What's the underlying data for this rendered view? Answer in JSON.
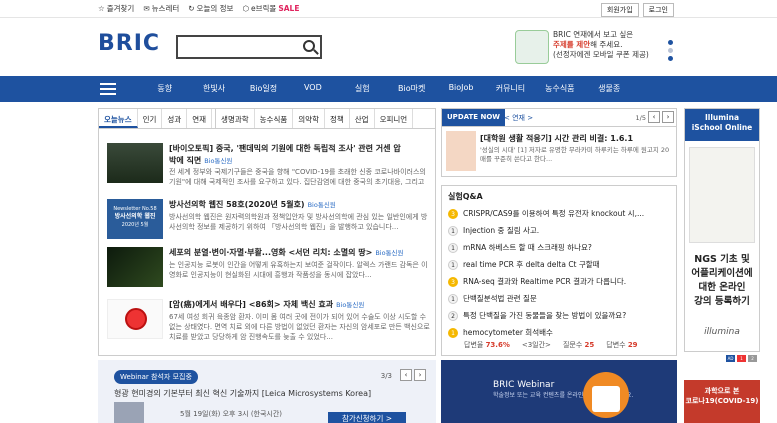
{
  "topbar": {
    "links": [
      "즐겨찾기",
      "뉴스레터",
      "오늘의 정보",
      "e브릭몰"
    ],
    "sale": "SALE",
    "login": "회원가입",
    "logout": "로그인"
  },
  "header": {
    "logo": "BRIC",
    "search_placeholder": "",
    "promo_line1": "BRIC 연재에서 보고 싶은",
    "promo_line2_a": "주제를 제안",
    "promo_line2_b": "해 주세요.",
    "promo_line3": "(선정자에겐 모바일 쿠폰 제공)",
    "dot_colors": [
      "#1e52a0",
      "#b9c3d6",
      "#1e52a0"
    ]
  },
  "nav": {
    "items": [
      "동향",
      "한빛사",
      "Bio일정",
      "VOD",
      "실험",
      "Bio마켓",
      "BioJob",
      "커뮤니티",
      "농수식품",
      "생물종"
    ]
  },
  "left": {
    "tabs": [
      "오늘뉴스",
      "인기",
      "성과",
      "연재",
      "생명과학",
      "농수식품",
      "의약학",
      "정책",
      "산업",
      "오피니언"
    ],
    "news": [
      {
        "title": "[바이오토픽] 중국, '팬데믹의 기원에 대한 독립적 조사' 관련 거센 압",
        "title2": "박에 직면",
        "source": "Bio통신원",
        "desc": "전 세계 정부와 국제기구들은 중국을 향해 \"COVID-19를 초래한 신종 코로나바이러스의 기원\"에 대해 국제적인 조사를 요구하고 있다. 집단감염에 대한 중국의 초기대응, 그리고 팬데믹의 기원에 대한 독립적·국제..."
      },
      {
        "title": "방사선의학 웹진 58호(2020년 5월호)",
        "source": "Bio통신원",
        "thumb_line1": "Newsletter No.58",
        "thumb_line2": "방사선의학 웹진",
        "thumb_line3": "2020년 5월",
        "desc": "방사선의학 웹진은 원자력의학원과 정책입안자 및 방사선의학에 관심 있는 일반인에게 방사선의학 정보를 제공하기 위하여 「방사선의학 웹진」을 발행하고 있습니다..."
      },
      {
        "title": "세포의 분열·변이·자멸·부활...영화 <서던 리치: 소멸의 땅>",
        "source": "Bio통신원",
        "desc": "는 인공지능 로봇이 인간을 어떻게 유혹하는지 보여준 걸작이다. 알렉스 가랜드 감독은 이 영화로 인공지능이 현실화된 시대에 흥행과 작품성을 동시에 잡았다..."
      },
      {
        "title": "[암(癌)에게서 배우다] <86회> 자체 백신 효과",
        "source": "Bio통신원",
        "desc": "67세 여성 회귀 육종암 환자. 이미 몸 여러 곳에 전이가 되어 있어 수술도 이상 시도할 수 없는 상태였다. 면역 치료 외에 다른 방법이 없었던 환자는 자신의 암세포로 만든 백신으로 치료를 받았고 당당하게 암 진행속도를 늦출 수 있었다..."
      }
    ]
  },
  "webinar_banner": {
    "tag": "Webinar 참석자 모집중",
    "page": "3/3",
    "title": "형광 현미경의 기본부터 최신 혁신 기술까지 [Leica Microsystems Korea]",
    "date": "5월 19일(화) 오후 3시 (한국시간)",
    "cta": "참가신청하기 >"
  },
  "update": {
    "label": "UPDATE NOW",
    "category": "< 연재 >",
    "page": "1/5",
    "title": "[대학원 생활 적응기] 시간 관리 비결: 1.6.1",
    "desc": "'성실의 시대' [1] 저자로 유명한 무라카미 하루키는 하루에 원고지 20매를 꾸준히 쓴다고 한다..."
  },
  "qa": {
    "title": "실험Q&A",
    "items": [
      {
        "n": "3",
        "hot": true,
        "text": "CRISPR/CAS9를 이용하여 특정 유전자 knockout 시,..."
      },
      {
        "n": "1",
        "hot": false,
        "text": "Injection 중 질림 사고."
      },
      {
        "n": "1",
        "hot": false,
        "text": "mRNA 하베스트 할 때 스크래핑 하나요?"
      },
      {
        "n": "1",
        "hot": false,
        "text": "real time PCR 후 delta delta Ct 구할때"
      },
      {
        "n": "3",
        "hot": true,
        "text": "RNA-seq 결과와 Realtime PCR 결과가 다릅니다."
      },
      {
        "n": "1",
        "hot": false,
        "text": "단백질분석법 관련 질문"
      },
      {
        "n": "2",
        "hot": false,
        "text": "특정 단백질을 가진 동물들을 찾는 방법이 있을까요?"
      },
      {
        "n": "1",
        "hot": true,
        "text": "hemocytometer 희석배수"
      }
    ],
    "stats": {
      "answer_label": "답변율",
      "answer_rate": "73.6%",
      "period": "<3일간>",
      "question_label": "질문수",
      "question_count": "25",
      "reply_label": "답변수",
      "reply_count": "29"
    }
  },
  "webinar_promo": {
    "title": "BRIC Webinar",
    "desc": "학술정보 또는 교육 컨텐츠를 온라인 세미나로 함께해요."
  },
  "ad": {
    "header_line1": "Illumina",
    "header_line2": "iSchool Online",
    "body": [
      "NGS 기초 및",
      "어플리케이션에",
      "대한 온라인",
      "강의 등록하기"
    ],
    "brand": "illumina",
    "tags": [
      "AD",
      "1",
      "2"
    ],
    "banner_line1": "과학으로 본",
    "banner_line2": "코로나19(COVID-19)"
  }
}
